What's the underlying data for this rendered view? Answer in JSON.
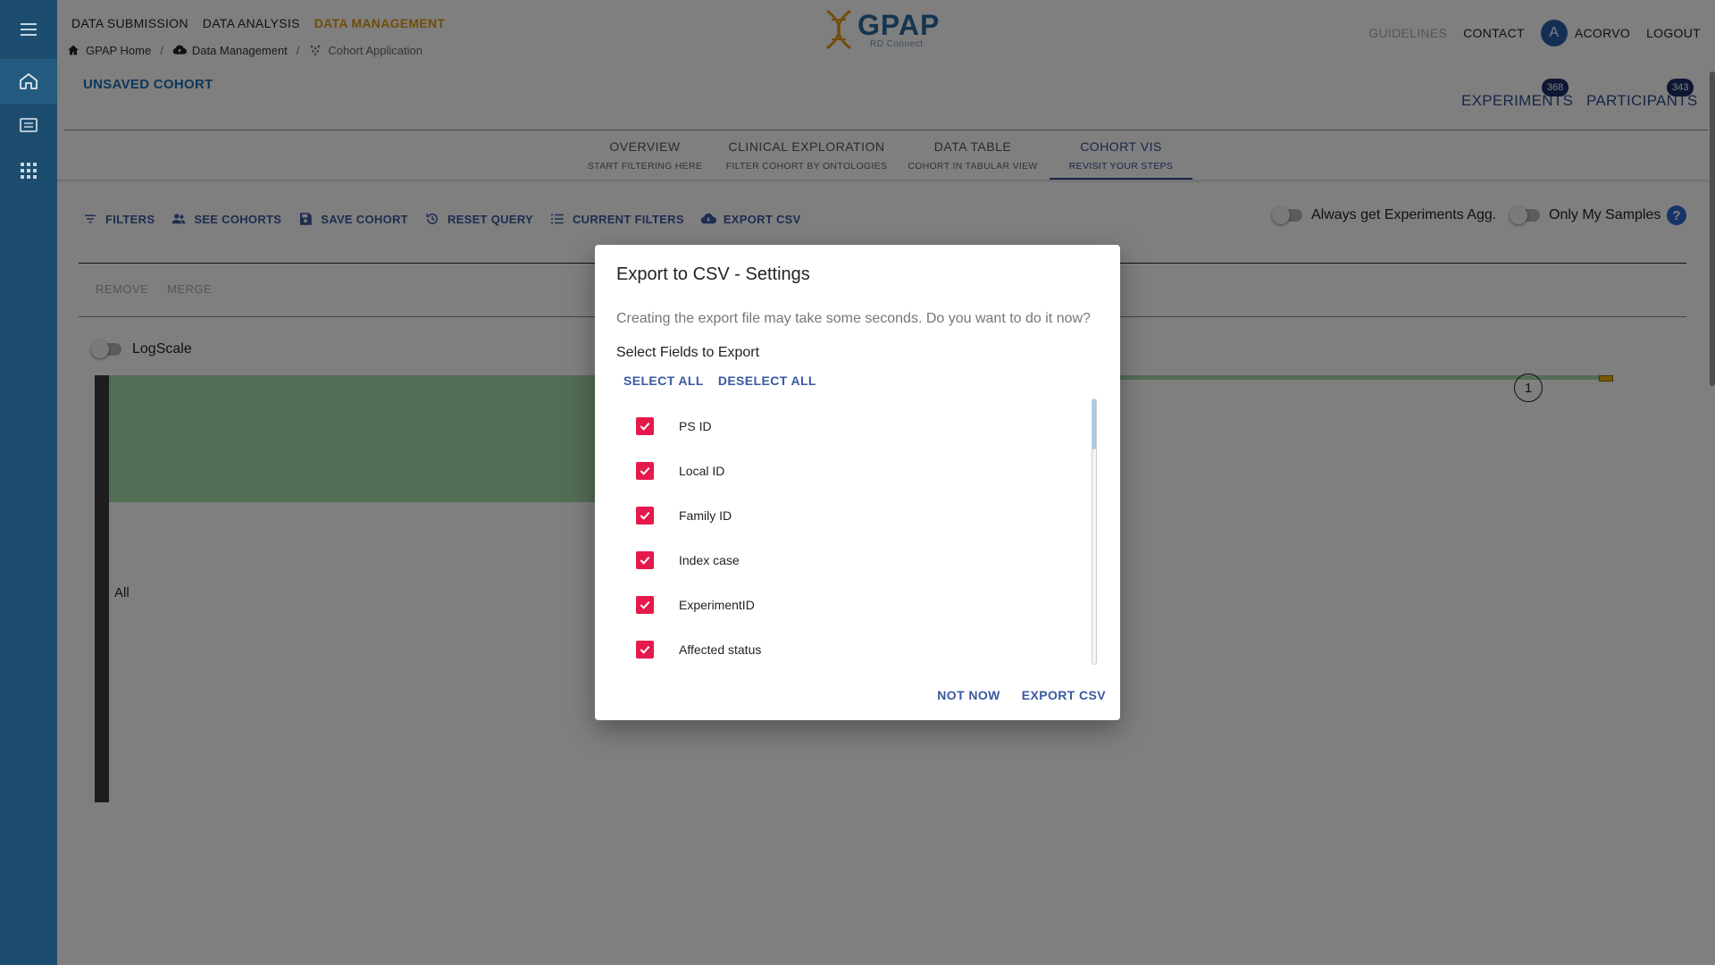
{
  "nav": {
    "items": [
      "DATA SUBMISSION",
      "DATA ANALYSIS",
      "DATA MANAGEMENT"
    ]
  },
  "breadcrumbs": [
    "GPAP Home",
    "Data Management",
    "Cohort Application"
  ],
  "logo": {
    "name": "GPAP",
    "sub": "RD Connect"
  },
  "header_right": {
    "guidelines": "GUIDELINES",
    "contact": "CONTACT",
    "avatar_letter": "A",
    "username": "ACORVO",
    "logout": "LOGOUT"
  },
  "cohort": {
    "title": "UNSAVED COHORT"
  },
  "counters": {
    "experiments": {
      "label": "EXPERIMENTS",
      "count": "368"
    },
    "participants": {
      "label": "PARTICIPANTS",
      "count": "343"
    }
  },
  "tabs": [
    {
      "title": "OVERVIEW",
      "subtitle": "START FILTERING HERE"
    },
    {
      "title": "CLINICAL EXPLORATION",
      "subtitle": "FILTER COHORT BY ONTOLOGIES"
    },
    {
      "title": "DATA TABLE",
      "subtitle": "COHORT IN TABULAR VIEW"
    },
    {
      "title": "COHORT VIS",
      "subtitle": "REVISIT YOUR STEPS"
    }
  ],
  "toolbar": {
    "filters": "FILTERS",
    "see_cohorts": "SEE COHORTS",
    "save_cohort": "SAVE COHORT",
    "reset_query": "RESET QUERY",
    "current_filters": "CURRENT FILTERS",
    "export_csv": "EXPORT CSV"
  },
  "toggles": {
    "always_agg": "Always get Experiments Agg.",
    "only_my_samples": "Only My Samples",
    "help": "?"
  },
  "actions": {
    "remove": "REMOVE",
    "merge": "MERGE"
  },
  "vis": {
    "logscale": "LogScale",
    "root_label": "All",
    "node_label": "1"
  },
  "dialog": {
    "title": "Export to CSV - Settings",
    "description": "Creating the export file may take some seconds. Do you want to do it now?",
    "subtitle": "Select Fields to Export",
    "select_all": "SELECT ALL",
    "deselect_all": "DESELECT ALL",
    "fields": [
      {
        "label": "PS ID",
        "checked": true
      },
      {
        "label": "Local ID",
        "checked": true
      },
      {
        "label": "Family ID",
        "checked": true
      },
      {
        "label": "Index case",
        "checked": true
      },
      {
        "label": "ExperimentID",
        "checked": true
      },
      {
        "label": "Affected status",
        "checked": true
      }
    ],
    "not_now": "NOT NOW",
    "export": "EXPORT CSV"
  },
  "colors": {
    "rail": "#1c4d6e",
    "accent": "#3b59a0",
    "active_nav": "#e39b11",
    "checkbox": "#e6194b",
    "vis_green": "#a6d9a8"
  }
}
